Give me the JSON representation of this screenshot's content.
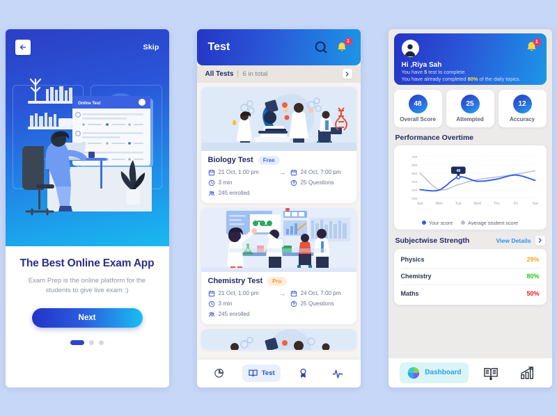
{
  "screen1": {
    "back_icon": "back-arrow-icon",
    "skip_label": "Skip",
    "illustration_label": "Online Test",
    "title": "The Best Online Exam App",
    "subtitle": "Exam Prep is the online platform for the students to give live exam :)",
    "next_label": "Next",
    "dots": [
      {
        "active": true
      },
      {
        "active": false
      },
      {
        "active": false
      }
    ]
  },
  "screen2": {
    "header": {
      "title": "Test",
      "search_icon": "search-icon",
      "bell_icon": "bell-icon",
      "notification_count": "1"
    },
    "section_bar": {
      "label": "All Tests",
      "count": "6 in total",
      "chevron_icon": "chevron-right-icon"
    },
    "cards": [
      {
        "name": "Biology Test",
        "badge": "Free",
        "badge_type": "free",
        "start": "21 Oct, 1:00 pm",
        "end": "24 Oct, 7:00 pm",
        "duration": "3 min",
        "questions": "25 Questions",
        "enrolled": "245 enrolled",
        "illustration": "biology-lab-illustration"
      },
      {
        "name": "Chemistry Test",
        "badge": "Pro",
        "badge_type": "pro",
        "start": "21 Oct, 1:00 pm",
        "end": "24 Oct, 7:00 pm",
        "duration": "3 min",
        "questions": "25 Questions",
        "enrolled": "245 enrolled",
        "illustration": "chemistry-lab-illustration"
      }
    ],
    "nav": [
      {
        "icon": "pie-chart-icon",
        "label": "",
        "active": false
      },
      {
        "icon": "book-icon",
        "label": "Test",
        "active": true
      },
      {
        "icon": "award-icon",
        "label": "",
        "active": false
      },
      {
        "icon": "activity-pulse-icon",
        "label": "",
        "active": false
      }
    ]
  },
  "screen3": {
    "profile": {
      "avatar_icon": "user-avatar-icon",
      "greeting": "Hi ,Riya Sah",
      "line1_pre": "You have ",
      "line1_hl": "5",
      "line1_post": " test to complete.",
      "line2_pre": "You have already completed ",
      "line2_hl": "80%",
      "line2_post": " of the daily topics.",
      "bell_icon": "bell-icon",
      "notification_count": "1"
    },
    "stats": [
      {
        "value": "48",
        "label": "Overall Score"
      },
      {
        "value": "25",
        "label": "Attempted"
      },
      {
        "value": "12",
        "label": "Accuracy"
      }
    ],
    "performance_title": "Performance  Overtime",
    "subject_title": "Subjectwise Strength",
    "view_details_label": "View Details",
    "view_details_chevron": "chevron-right-icon",
    "subjects": [
      {
        "name": "Physics",
        "value": "29%",
        "color": "#f5a623"
      },
      {
        "name": "Chemistry",
        "value": "80%",
        "color": "#1ec81e"
      },
      {
        "name": "Maths",
        "value": "50%",
        "color": "#e8191b"
      }
    ],
    "nav": [
      {
        "icon": "pie-chart-color-icon",
        "label": "Dashboard",
        "active": true
      },
      {
        "icon": "book-open-icon",
        "label": "",
        "active": false
      },
      {
        "icon": "bar-chart-growth-icon",
        "label": "",
        "active": false
      }
    ]
  },
  "chart_data": {
    "type": "line",
    "title": "Performance  Overtime",
    "xlabel": "",
    "ylabel": "",
    "categories": [
      "Sun",
      "Mon",
      "Tue",
      "Wed",
      "Thu",
      "Fri",
      "Sat"
    ],
    "ytick_labels": [
      "000",
      "020",
      "040",
      "060",
      "080",
      "100"
    ],
    "ylim": [
      0,
      100
    ],
    "grid": true,
    "legend_position": "bottom",
    "annotation": {
      "label": "48",
      "at_category": "Tue",
      "value": 50
    },
    "series": [
      {
        "name": "Your score",
        "color": "#2f5fe0",
        "values": [
          20,
          19,
          50,
          40,
          45,
          55,
          42
        ]
      },
      {
        "name": "Average student score",
        "color": "#b9bdc9",
        "values": [
          60,
          20,
          32,
          44,
          50,
          57,
          65
        ]
      }
    ]
  }
}
